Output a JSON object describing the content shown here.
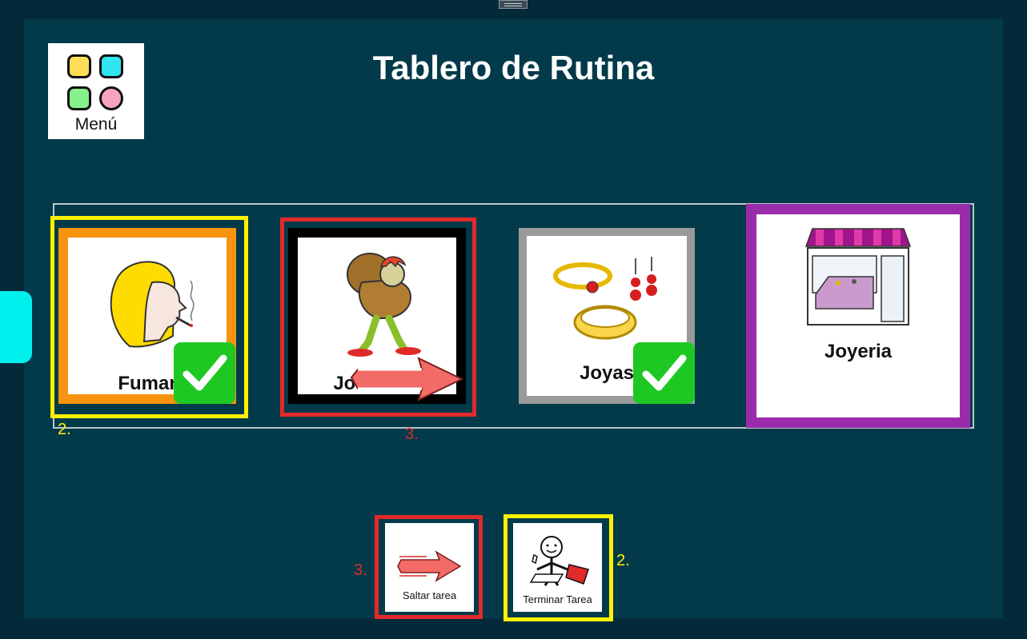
{
  "title": "Tablero de Rutina",
  "menu": {
    "label": "Menú",
    "icon": "menu-grid-icon"
  },
  "routine": [
    {
      "label": "Fumar",
      "status": "done",
      "frame_color": "#f7930e",
      "icon": "smoking-person-icon",
      "annotation": "2."
    },
    {
      "label": "Jorobado",
      "status": "current",
      "frame_color": "#000000",
      "icon": "hunchback-icon",
      "annotation": "3."
    },
    {
      "label": "Joyas",
      "status": "done",
      "frame_color": "#9a9a9a",
      "icon": "jewelry-icon"
    },
    {
      "label": "Joyeria",
      "status": "pending",
      "frame_color": "#9a2cab",
      "icon": "jewelry-store-icon"
    }
  ],
  "actions": {
    "skip": {
      "label": "Saltar tarea",
      "annotation": "3.",
      "icon": "skip-arrow-icon"
    },
    "finish": {
      "label": "Terminar Tarea",
      "annotation": "2.",
      "icon": "finish-task-icon"
    }
  },
  "colors": {
    "background": "#023a4a",
    "highlight_yellow": "#fff200",
    "highlight_red": "#e12a2a",
    "check_green": "#1ec823",
    "side_tab": "#00f0ee"
  }
}
